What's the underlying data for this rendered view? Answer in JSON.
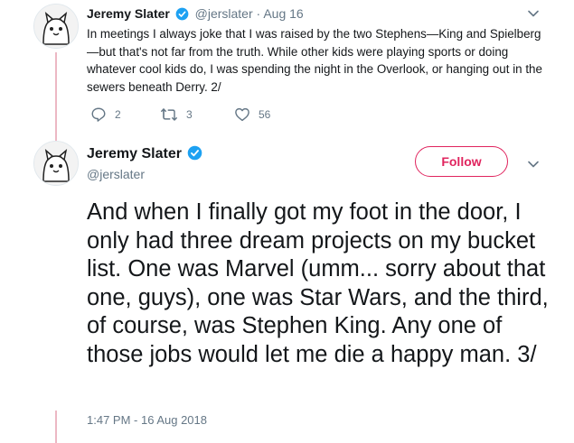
{
  "tweet1": {
    "author_name": "Jeremy Slater",
    "author_handle": "@jerslater",
    "date": "Aug 16",
    "separator": "·",
    "text": "In meetings I always joke that I was raised by the two Stephens—King and Spielberg—but that's not far from the truth. While other kids were playing sports or doing whatever cool kids do, I was spending the night in the Overlook, or hanging out in the sewers beneath Derry. 2/",
    "replies": "2",
    "retweets": "3",
    "likes": "56"
  },
  "tweet2": {
    "author_name": "Jeremy Slater",
    "author_handle": "@jerslater",
    "follow_label": "Follow",
    "text": "And when I finally got my foot in the door, I only had three dream projects on my bucket list. One was Marvel (umm... sorry about that one, guys), one was Star Wars, and the third, of course, was Stephen King. Any one of those jobs would let me die a happy man. 3/",
    "timestamp": "1:47 PM - 16 Aug 2018"
  },
  "icons": {
    "verified": "verified-badge-icon",
    "reply": "reply-icon",
    "retweet": "retweet-icon",
    "like": "heart-icon",
    "more": "chevron-down-icon"
  },
  "colors": {
    "verified": "#1da1f2",
    "follow_accent": "#e0245e",
    "thread_line": "#ecb8c4",
    "secondary_text": "#657786"
  }
}
